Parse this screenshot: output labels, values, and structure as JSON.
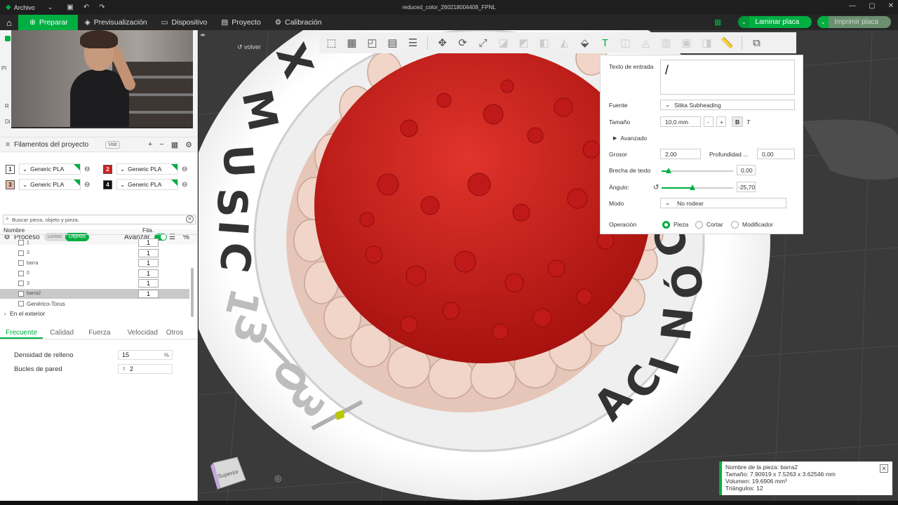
{
  "titlebar": {
    "menu_label": "Archivo",
    "file_title": "reduced_color_260218004408_FPNL"
  },
  "nav": {
    "tabs": [
      {
        "label": "Preparar",
        "active": true
      },
      {
        "label": "Previsualización",
        "active": false
      },
      {
        "label": "Dispositivo",
        "active": false
      },
      {
        "label": "Proyecto",
        "active": false
      },
      {
        "label": "Calibración",
        "active": false
      }
    ],
    "slice_label": "Laminar placa",
    "print_label": "Imprimir placa"
  },
  "sidebar": {
    "cut_labels": [
      "Pl",
      "R",
      "Di"
    ],
    "filaments_title": "Filamentos del proyecto",
    "filaments_chip": "Volc",
    "filaments": [
      {
        "num": "1",
        "name": "Generic PLA",
        "color": "#ffffff"
      },
      {
        "num": "2",
        "name": "Generic PLA",
        "color": "#d32222"
      },
      {
        "num": "3",
        "name": "Generic PLA",
        "color": "#e8b9a8"
      },
      {
        "num": "4",
        "name": "Generic PLA",
        "color": "#111111"
      }
    ],
    "process_title": "Proceso",
    "process_global": "Global",
    "process_objects": "Objetos",
    "advanced_label": "Avanzar",
    "search_placeholder": "Buscar pieza, objeto y pieza.",
    "table_headers": {
      "name": "Nombre",
      "fila": "Fila."
    },
    "objects": [
      {
        "name": "1",
        "count": "1",
        "selected": false
      },
      {
        "name": "3",
        "count": "1",
        "selected": false
      },
      {
        "name": "barra",
        "count": "1",
        "selected": false
      },
      {
        "name": "0",
        "count": "1",
        "selected": false
      },
      {
        "name": "3",
        "count": "1",
        "selected": false
      },
      {
        "name": "barra2",
        "count": "1",
        "selected": true
      }
    ],
    "extra_rows": [
      "Genérico-Torus",
      "En el exterior"
    ],
    "tabs": [
      "Frecuente",
      "Calidad",
      "Fuerza",
      "Velocidad",
      "Otros"
    ],
    "settings": [
      {
        "label": "Densidad de relleno",
        "value": "15",
        "unit": "%"
      },
      {
        "label": "Bucles de pared",
        "value": "2",
        "unit": ""
      }
    ]
  },
  "viewport": {
    "back_label": "volver",
    "ring_text": "XMUSIC 13/03 CÓNICA",
    "navcube_label": "Superior"
  },
  "text_panel": {
    "input_label": "Texto de entrada",
    "input_value": "/",
    "font_label": "Fuente",
    "font_value": "Sitka Subheading",
    "size_label": "Tamaño",
    "size_value": "10,0 mm",
    "bold_label": "B",
    "italic_label": "T",
    "advanced_label": "Avanzado",
    "thickness_label": "Grosor",
    "thickness_value": "2,00",
    "depth_label": "Profundidad ...",
    "depth_value": "0,00",
    "gap_label": "Brecha de texto",
    "gap_value": "0,00",
    "gap_fraction": 0.1,
    "angle_label": "Ángulo:",
    "angle_value": "-25,70",
    "angle_fraction": 0.43,
    "mode_label": "Modo",
    "mode_value": "No rodear",
    "operation_label": "Operación",
    "op_part": "Pieza",
    "op_cut": "Cortar",
    "op_modifier": "Modificador"
  },
  "info_panel": {
    "name_line": "Nombre de la pieza: barra2",
    "size_line": "Tamaño: 7.90919 x 7.5263 x 3.62546 mm",
    "volume_line": "Volumen: 19.6906 mm³",
    "triangles_line": "Triángulos: 12"
  },
  "colors": {
    "accent": "#00ae42",
    "base_red": "#d32222",
    "ring": "#ffffff",
    "shell": "#e8c4b4"
  }
}
